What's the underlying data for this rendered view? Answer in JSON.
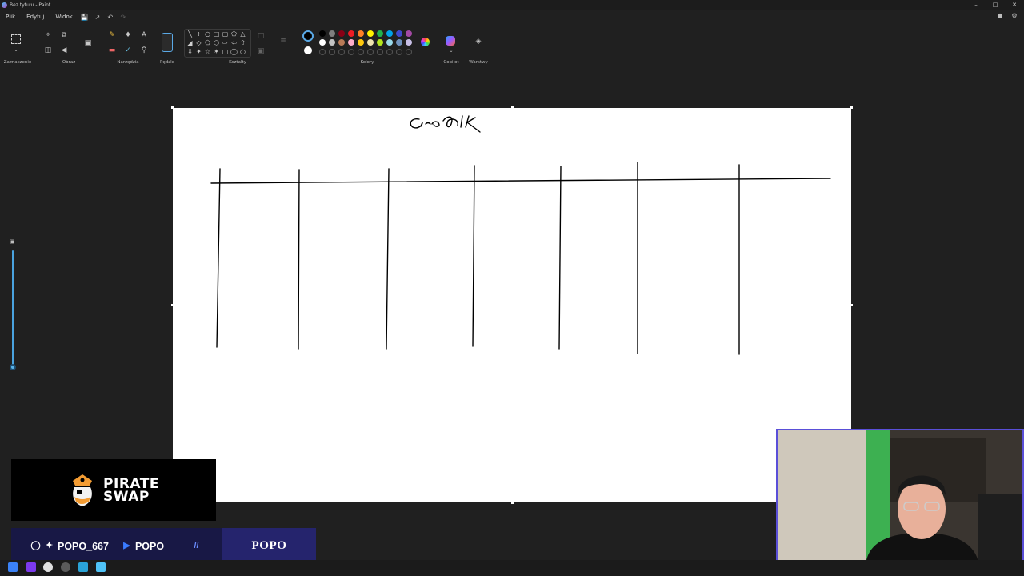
{
  "window": {
    "title": "Bez tytułu - Paint"
  },
  "menu": {
    "file": "Plik",
    "edit": "Edytuj",
    "view": "Widok"
  },
  "ribbon": {
    "groups": {
      "selection": "Zaznaczenie",
      "image": "Obraz",
      "tools": "Narzędzia",
      "brushes": "Pędzle",
      "shapes": "Kształty",
      "colors": "Kolory",
      "copilot": "Copilot",
      "layers": "Warstwy"
    },
    "colors": {
      "primary": "#000000",
      "secondary": "#ffffff",
      "palette_row1": [
        "#000000",
        "#7f7f7f",
        "#880015",
        "#ed1c24",
        "#ff7f27",
        "#fff200",
        "#22b14c",
        "#00a2e8",
        "#3f48cc",
        "#a349a4"
      ],
      "palette_row2": [
        "#ffffff",
        "#c3c3c3",
        "#b97a57",
        "#ffaec9",
        "#ffc90e",
        "#efe4b0",
        "#b5e61d",
        "#99d9ea",
        "#7092be",
        "#c8bfe7"
      ]
    }
  },
  "canvas": {
    "background": "#ffffff",
    "handwritten_title": "Grafik"
  },
  "overlay": {
    "sponsor": {
      "line1": "PIRATE",
      "line2": "SWAP"
    },
    "social": {
      "handle": "POPO_667",
      "channel": "POPO"
    },
    "name_badge": "POPO"
  }
}
